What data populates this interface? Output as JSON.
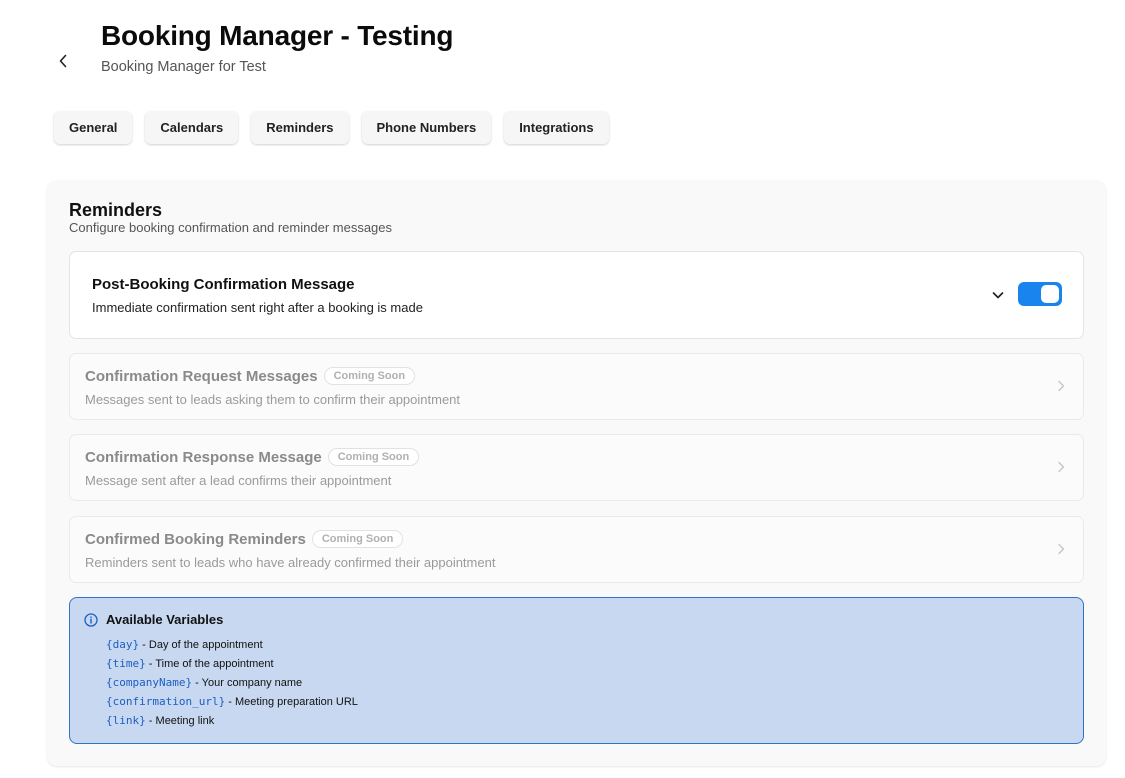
{
  "header": {
    "title": "Booking Manager - Testing",
    "subtitle": "Booking Manager for Test",
    "back_icon": "chevron-left-icon"
  },
  "tabs": [
    {
      "label": "General"
    },
    {
      "label": "Calendars"
    },
    {
      "label": "Reminders"
    },
    {
      "label": "Phone Numbers"
    },
    {
      "label": "Integrations"
    }
  ],
  "reminders": {
    "title": "Reminders",
    "description": "Configure booking confirmation and reminder messages",
    "post_booking": {
      "title": "Post-Booking Confirmation Message",
      "description": "Immediate confirmation sent right after a booking is made",
      "enabled": true
    },
    "coming_soon": [
      {
        "title": "Confirmation Request Messages",
        "badge": "Coming Soon",
        "description": "Messages sent to leads asking them to confirm their appointment"
      },
      {
        "title": "Confirmation Response Message",
        "badge": "Coming Soon",
        "description": "Message sent after a lead confirms their appointment"
      },
      {
        "title": "Confirmed Booking Reminders",
        "badge": "Coming Soon",
        "description": "Reminders sent to leads who have already confirmed their appointment"
      }
    ],
    "variables": {
      "title": "Available Variables",
      "items": [
        {
          "name": "{day}",
          "desc": " - Day of the appointment"
        },
        {
          "name": "{time}",
          "desc": " - Time of the appointment"
        },
        {
          "name": "{companyName}",
          "desc": " - Your company name"
        },
        {
          "name": "{confirmation_url}",
          "desc": " - Meeting preparation URL"
        },
        {
          "name": "{link}",
          "desc": " - Meeting link"
        }
      ]
    }
  },
  "colors": {
    "accent": "#1a84ee",
    "info_bg": "#c8d8f0",
    "info_border": "#2f74c8",
    "variable_text": "#1a5fc4"
  }
}
